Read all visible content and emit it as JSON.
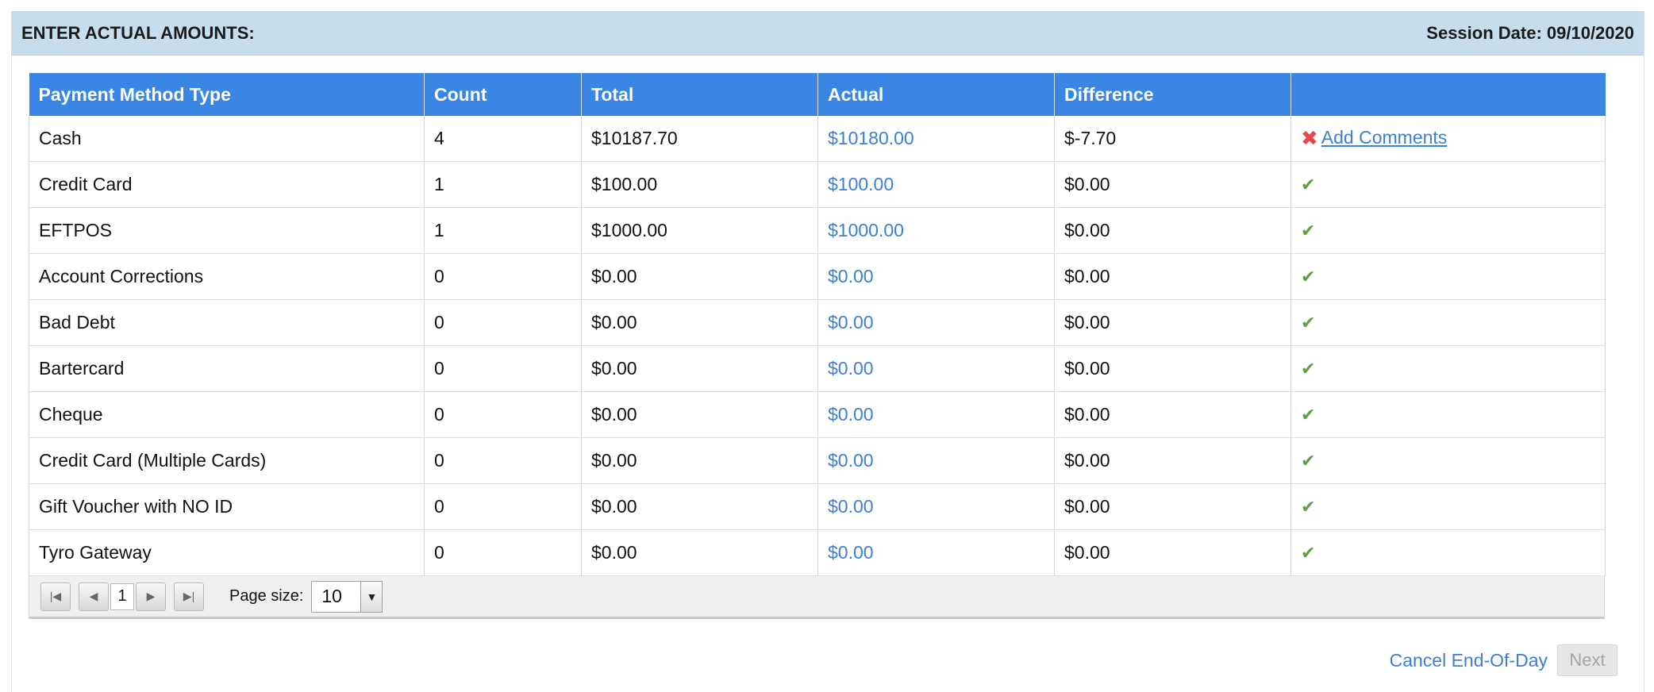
{
  "header": {
    "title": "ENTER ACTUAL AMOUNTS:",
    "session_label": "Session Date: ",
    "session_date": "09/10/2020"
  },
  "table": {
    "columns": [
      "Payment Method Type",
      "Count",
      "Total",
      "Actual",
      "Difference",
      ""
    ],
    "rows": [
      {
        "method": "Cash",
        "count": "4",
        "total": "$10187.70",
        "actual": "$10180.00",
        "difference": "$-7.70",
        "status": "mismatch",
        "status_text": "Add Comments"
      },
      {
        "method": "Credit Card",
        "count": "1",
        "total": "$100.00",
        "actual": "$100.00",
        "difference": "$0.00",
        "status": "ok"
      },
      {
        "method": "EFTPOS",
        "count": "1",
        "total": "$1000.00",
        "actual": "$1000.00",
        "difference": "$0.00",
        "status": "ok"
      },
      {
        "method": "Account Corrections",
        "count": "0",
        "total": "$0.00",
        "actual": "$0.00",
        "difference": "$0.00",
        "status": "ok"
      },
      {
        "method": "Bad Debt",
        "count": "0",
        "total": "$0.00",
        "actual": "$0.00",
        "difference": "$0.00",
        "status": "ok"
      },
      {
        "method": "Bartercard",
        "count": "0",
        "total": "$0.00",
        "actual": "$0.00",
        "difference": "$0.00",
        "status": "ok"
      },
      {
        "method": "Cheque",
        "count": "0",
        "total": "$0.00",
        "actual": "$0.00",
        "difference": "$0.00",
        "status": "ok"
      },
      {
        "method": "Credit Card (Multiple Cards)",
        "count": "0",
        "total": "$0.00",
        "actual": "$0.00",
        "difference": "$0.00",
        "status": "ok"
      },
      {
        "method": "Gift Voucher with NO ID",
        "count": "0",
        "total": "$0.00",
        "actual": "$0.00",
        "difference": "$0.00",
        "status": "ok"
      },
      {
        "method": "Tyro Gateway",
        "count": "0",
        "total": "$0.00",
        "actual": "$0.00",
        "difference": "$0.00",
        "status": "ok"
      }
    ]
  },
  "pager": {
    "current_page": "1",
    "page_size_label": "Page size:",
    "page_size": "10",
    "icons": {
      "first": "first-page-icon",
      "prev": "previous-page-icon",
      "next": "next-page-icon",
      "last": "last-page-icon",
      "dropdown": "chevron-down-icon"
    }
  },
  "footer": {
    "cancel_label": "Cancel End-Of-Day",
    "next_label": "Next"
  },
  "colors": {
    "header_bg": "#c6dded",
    "table_header_bg": "#3a86e4",
    "link": "#3a7fd8",
    "ok_check": "#5ea04a",
    "error_x": "#e8474a"
  }
}
